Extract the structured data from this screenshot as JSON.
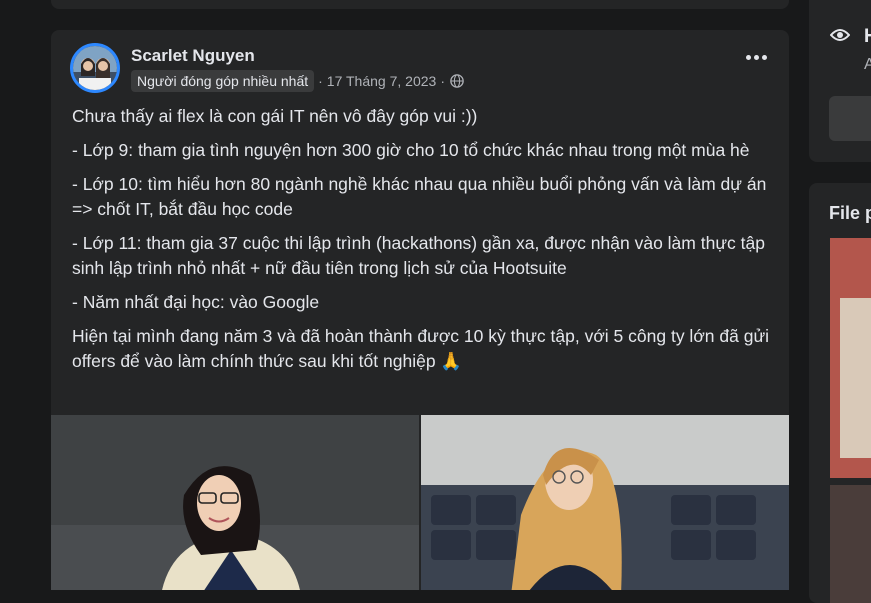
{
  "post": {
    "author": "Scarlet Nguyen",
    "badge": "Người đóng góp nhiều nhất",
    "date": "17 Tháng 7, 2023",
    "paragraphs": [
      "Chưa thấy ai flex là con gái IT nên vô đây góp vui :))",
      "- Lớp 9: tham gia tình nguyện hơn 300 giờ cho 10 tổ chức khác nhau trong một mùa hè",
      "- Lớp 10: tìm hiểu hơn 80 ngành nghề khác nhau qua nhiều buổi phỏng vấn và làm dự án => chốt IT, bắt đầu học code",
      "- Lớp 11: tham gia 37 cuộc thi lập trình (hackathons) gần xa, được nhận vào làm thực tập sinh lập trình nhỏ nhất + nữ đầu tiên trong lịch sử của Hootsuite",
      "- Năm nhất đại học: vào Google",
      "Hiện tại mình đang năm 3 và đã hoàn thành được 10 kỳ thực tập, với 5 công ty lớn đã gửi offers để vào làm chính thức sau khi tốt nghiệp 🙏"
    ]
  },
  "sidebar": {
    "item_letter": "H",
    "item_sub": "A",
    "files_title": "File p"
  },
  "icons": {
    "more": "more-horizontal-icon",
    "audience": "globe-icon",
    "sidebar_item": "eye-icon"
  },
  "colors": {
    "accent": "#2d88ff",
    "card": "#242526",
    "background": "#18191a"
  }
}
